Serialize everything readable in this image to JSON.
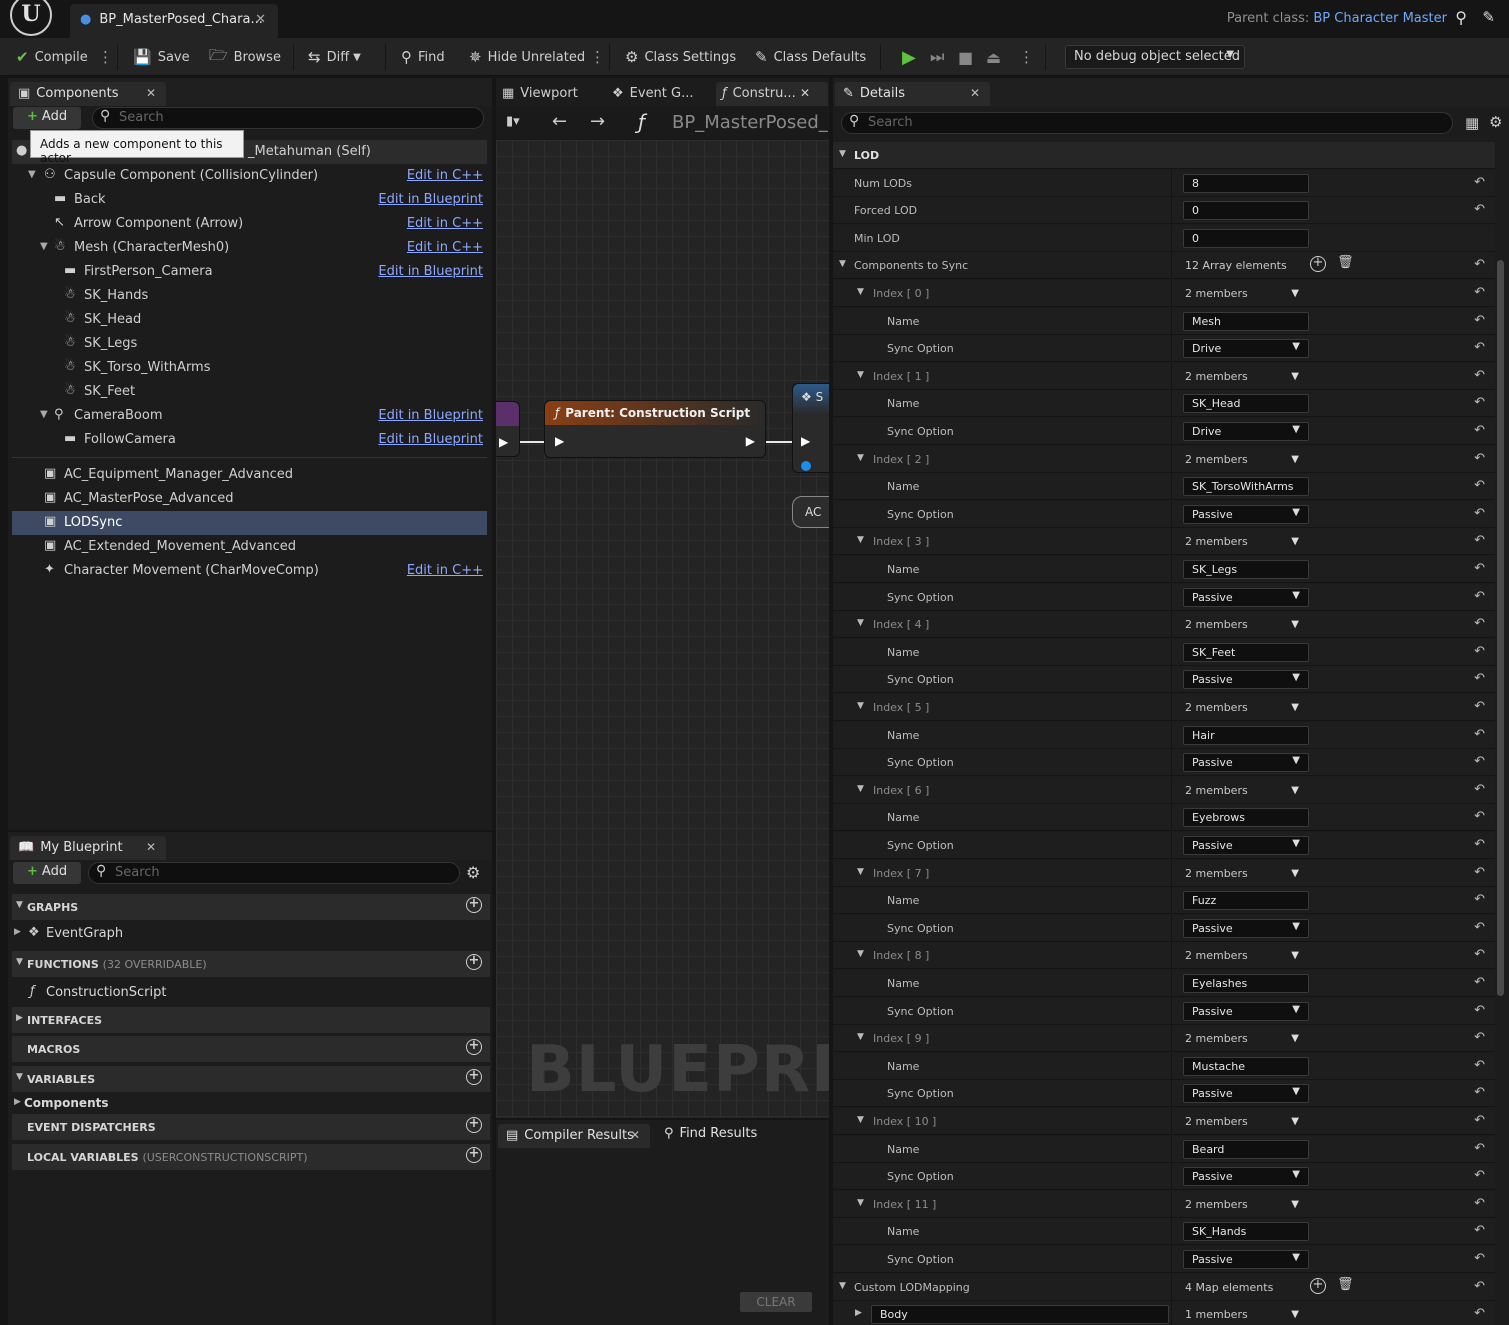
{
  "title_bar": {
    "logo": "U",
    "doc_tab": "BP_MasterPosed_Chara...",
    "parent_class_label": "Parent class:",
    "parent_class_value": "BP Character Master"
  },
  "toolbar": {
    "compile": "Compile",
    "save": "Save",
    "browse": "Browse",
    "diff": "Diff",
    "find": "Find",
    "hide_unrelated": "Hide Unrelated",
    "class_settings": "Class Settings",
    "class_defaults": "Class Defaults",
    "debug_select": "No debug object selected"
  },
  "components": {
    "tab_label": "Components",
    "add_label": "Add",
    "search_placeholder": "Search",
    "tooltip": "Adds a new component to this actor",
    "root_label": "_Metahuman (Self)",
    "tree": [
      {
        "label": "Capsule Component (CollisionCylinder)",
        "link": "Edit in C++"
      },
      {
        "label": "Back",
        "link": "Edit in Blueprint"
      },
      {
        "label": "Arrow Component (Arrow)",
        "link": "Edit in C++"
      },
      {
        "label": "Mesh (CharacterMesh0)",
        "link": "Edit in C++"
      },
      {
        "label": "FirstPerson_Camera",
        "link": "Edit in Blueprint"
      },
      {
        "label": "SK_Hands",
        "link": ""
      },
      {
        "label": "SK_Head",
        "link": ""
      },
      {
        "label": "SK_Legs",
        "link": ""
      },
      {
        "label": "SK_Torso_WithArms",
        "link": ""
      },
      {
        "label": "SK_Feet",
        "link": ""
      },
      {
        "label": "CameraBoom",
        "link": "Edit in Blueprint"
      },
      {
        "label": "FollowCamera",
        "link": "Edit in Blueprint"
      }
    ],
    "actor_components": [
      {
        "label": "AC_Equipment_Manager_Advanced",
        "link": ""
      },
      {
        "label": "AC_MasterPose_Advanced",
        "link": ""
      },
      {
        "label": "LODSync",
        "link": ""
      },
      {
        "label": "AC_Extended_Movement_Advanced",
        "link": ""
      },
      {
        "label": "Character Movement (CharMoveComp)",
        "link": "Edit in C++"
      }
    ]
  },
  "my_blueprint": {
    "tab_label": "My Blueprint",
    "add_label": "Add",
    "search_placeholder": "Search",
    "graphs": "GRAPHS",
    "event_graph": "EventGraph",
    "functions": "FUNCTIONS",
    "functions_sub": "(32 OVERRIDABLE)",
    "construction_script": "ConstructionScript",
    "interfaces": "INTERFACES",
    "macros": "MACROS",
    "variables": "VARIABLES",
    "components_var": "Components",
    "event_dispatchers": "EVENT DISPATCHERS",
    "local_variables": "LOCAL VARIABLES",
    "local_variables_sub": "(USERCONSTRUCTIONSCRIPT)"
  },
  "graph": {
    "tab_viewport": "Viewport",
    "tab_event": "Event G...",
    "tab_construct": "Constru...",
    "breadcrumb": "BP_MasterPosed_",
    "node_title": "Parent: Construction Script",
    "node_partial_1": "S",
    "node_partial_2": "AC",
    "watermark": "BLUEPRINT"
  },
  "results": {
    "compiler_results": "Compiler Results",
    "find_results": "Find Results",
    "clear": "CLEAR"
  },
  "details": {
    "tab_label": "Details",
    "search_placeholder": "Search",
    "category": "LOD",
    "num_lods_label": "Num LODs",
    "num_lods": "8",
    "forced_lod_label": "Forced LOD",
    "forced_lod": "0",
    "min_lod_label": "Min LOD",
    "min_lod": "0",
    "components_to_sync_label": "Components to Sync",
    "components_to_sync_count": "12 Array elements",
    "name_label": "Name",
    "sync_option_label": "Sync Option",
    "members_text": "2 members",
    "array": [
      {
        "index": "Index [ 0 ]",
        "name": "Mesh",
        "sync": "Drive"
      },
      {
        "index": "Index [ 1 ]",
        "name": "SK_Head",
        "sync": "Drive"
      },
      {
        "index": "Index [ 2 ]",
        "name": "SK_TorsoWithArms",
        "sync": "Passive"
      },
      {
        "index": "Index [ 3 ]",
        "name": "SK_Legs",
        "sync": "Passive"
      },
      {
        "index": "Index [ 4 ]",
        "name": "SK_Feet",
        "sync": "Passive"
      },
      {
        "index": "Index [ 5 ]",
        "name": "Hair",
        "sync": "Passive"
      },
      {
        "index": "Index [ 6 ]",
        "name": "Eyebrows",
        "sync": "Passive"
      },
      {
        "index": "Index [ 7 ]",
        "name": "Fuzz",
        "sync": "Passive"
      },
      {
        "index": "Index [ 8 ]",
        "name": "Eyelashes",
        "sync": "Passive"
      },
      {
        "index": "Index [ 9 ]",
        "name": "Mustache",
        "sync": "Passive"
      },
      {
        "index": "Index [ 10 ]",
        "name": "Beard",
        "sync": "Passive"
      },
      {
        "index": "Index [ 11 ]",
        "name": "SK_Hands",
        "sync": "Passive"
      }
    ],
    "custom_lod_mapping_label": "Custom LODMapping",
    "custom_lod_mapping_count": "4 Map elements",
    "map_first_key": "Body",
    "map_first_members": "1 members"
  }
}
